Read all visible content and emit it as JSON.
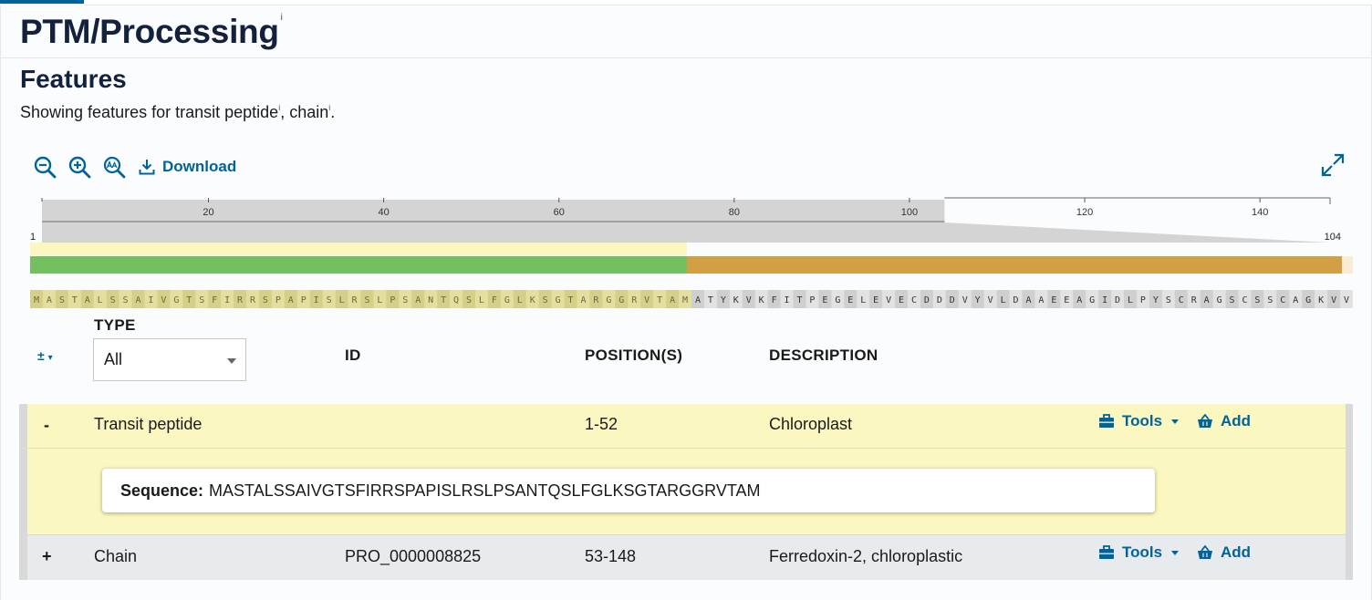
{
  "section": {
    "title": "PTM/Processing",
    "info_marker": "i"
  },
  "features": {
    "title": "Features",
    "showing_prefix": "Showing features for ",
    "showing_item1": "transit peptide",
    "showing_sep": ", ",
    "showing_item2": "chain",
    "showing_suffix": ".",
    "info_marker": "i"
  },
  "toolbar": {
    "zoom_out_icon": "zoom-out-icon",
    "zoom_in_icon": "zoom-in-icon",
    "font_size_icon": "font-size-icon",
    "download_label": "Download",
    "fullscreen_icon": "fullscreen-icon"
  },
  "navigator": {
    "ticks": [
      "20",
      "40",
      "60",
      "80",
      "100",
      "120",
      "140"
    ],
    "range_start": "1",
    "range_end": "104",
    "selection_end_value": 104,
    "sequence_length": 148
  },
  "sequence": "MASTALSSAIVGTSFIRRSPAPISLRSLPSANTQSLFGLKSGTARGGRVTAMATYKVKFITPEGELEVECDDDVYVLDAAEEAGIDLPYSCRAGSCSSCAGKVV",
  "colors": {
    "accent": "#00639a",
    "transit_peptide": "#72c05f",
    "chain": "#d29f45",
    "row_highlight": "#fbf7c0",
    "row_alt": "#e8ebee"
  },
  "table": {
    "toggle_label": "±",
    "headers": {
      "type": "TYPE",
      "id": "ID",
      "positions": "POSITION(S)",
      "description": "DESCRIPTION"
    },
    "type_filter_value": "All",
    "rows": [
      {
        "expand": "-",
        "type": "Transit peptide",
        "id": "",
        "positions": "1-52",
        "description": "Chloroplast",
        "tools_label": "Tools",
        "add_label": "Add",
        "sequence_label": "Sequence:",
        "sequence": "MASTALSSAIVGTSFIRRSPAPISLRSLPSANTQSLFGLKSGTARGGRVTAM"
      },
      {
        "expand": "+",
        "type": "Chain",
        "id": "PRO_0000008825",
        "positions": "53-148",
        "description": "Ferredoxin-2, chloroplastic",
        "tools_label": "Tools",
        "add_label": "Add"
      }
    ]
  }
}
